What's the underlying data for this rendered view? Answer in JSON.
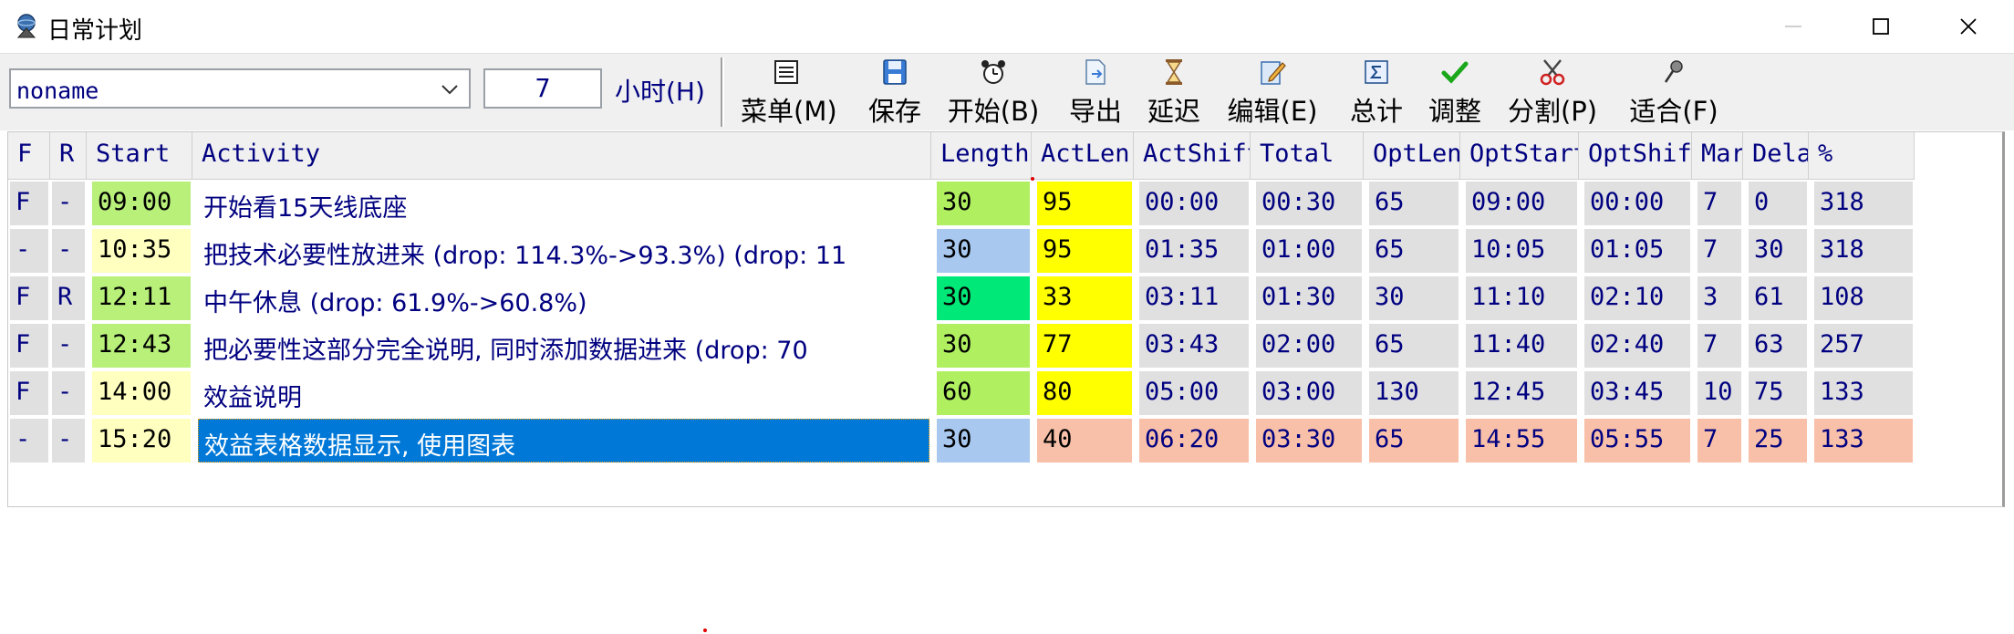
{
  "window": {
    "title": "日常计划"
  },
  "toolbar": {
    "project_combo": "noname",
    "hours_value": "7",
    "hours_label": "小时(H)",
    "buttons": [
      {
        "label": "菜单(M)",
        "icon": "menu-icon"
      },
      {
        "label": "保存",
        "icon": "save-icon"
      },
      {
        "label": "开始(B)",
        "icon": "alarm-clock-icon"
      },
      {
        "label": "导出",
        "icon": "export-icon"
      },
      {
        "label": "延迟",
        "icon": "hourglass-icon"
      },
      {
        "label": "编辑(E)",
        "icon": "edit-icon"
      },
      {
        "label": "总计",
        "icon": "sum-icon"
      },
      {
        "label": "调整",
        "icon": "checkmark-icon"
      },
      {
        "label": "分割(P)",
        "icon": "scissors-icon"
      },
      {
        "label": "适合(F)",
        "icon": "pin-icon"
      }
    ]
  },
  "grid": {
    "columns": [
      "F",
      "R",
      "Start",
      "Activity",
      "Length",
      "ActLen",
      "ActShift",
      "Total",
      "OptLen",
      "OptStart",
      "OptShift",
      "Mar",
      "Delay",
      "%"
    ],
    "rows": [
      {
        "f": "F",
        "r": "-",
        "start": "09:00",
        "activity": "开始看15天线底座",
        "length": "30",
        "actlen": "95",
        "actshift": "00:00",
        "total": "00:30",
        "optlen": "65",
        "optstart": "09:00",
        "optshift": "00:00",
        "mar": "7",
        "delay": "0",
        "pct": "318"
      },
      {
        "f": "-",
        "r": "-",
        "start": "10:35",
        "activity": "把技术必要性放进来 (drop: 114.3%->93.3%) (drop: 11",
        "length": "30",
        "actlen": "95",
        "actshift": "01:35",
        "total": "01:00",
        "optlen": "65",
        "optstart": "10:05",
        "optshift": "01:05",
        "mar": "7",
        "delay": "30",
        "pct": "318"
      },
      {
        "f": "F",
        "r": "R",
        "start": "12:11",
        "activity": "中午休息 (drop: 61.9%->60.8%)",
        "length": "30",
        "actlen": "33",
        "actshift": "03:11",
        "total": "01:30",
        "optlen": "30",
        "optstart": "11:10",
        "optshift": "02:10",
        "mar": "3",
        "delay": "61",
        "pct": "108"
      },
      {
        "f": "F",
        "r": "-",
        "start": "12:43",
        "activity": "把必要性这部分完全说明, 同时添加数据进来 (drop: 70",
        "length": "30",
        "actlen": "77",
        "actshift": "03:43",
        "total": "02:00",
        "optlen": "65",
        "optstart": "11:40",
        "optshift": "02:40",
        "mar": "7",
        "delay": "63",
        "pct": "257"
      },
      {
        "f": "F",
        "r": "-",
        "start": "14:00",
        "activity": "效益说明",
        "length": "60",
        "actlen": "80",
        "actshift": "05:00",
        "total": "03:00",
        "optlen": "130",
        "optstart": "12:45",
        "optshift": "03:45",
        "mar": "10",
        "delay": "75",
        "pct": "133"
      },
      {
        "f": "-",
        "r": "-",
        "start": "15:20",
        "activity": "效益表格数据显示, 使用图表",
        "length": "30",
        "actlen": "40",
        "actshift": "06:20",
        "total": "03:30",
        "optlen": "65",
        "optstart": "14:55",
        "optshift": "05:55",
        "mar": "7",
        "delay": "25",
        "pct": "133"
      }
    ]
  },
  "colors": {
    "start_normal": "#ffffc0",
    "start_done": "#b8f07a",
    "length_green": "#b0f060",
    "length_blue": "#a8c8f0",
    "length_bright": "#00e878",
    "actlen_yellow": "#ffff00",
    "actlen_salmon": "#f8c0a8",
    "grey_cell": "#e0e0e0",
    "selection": "#0078d7"
  }
}
